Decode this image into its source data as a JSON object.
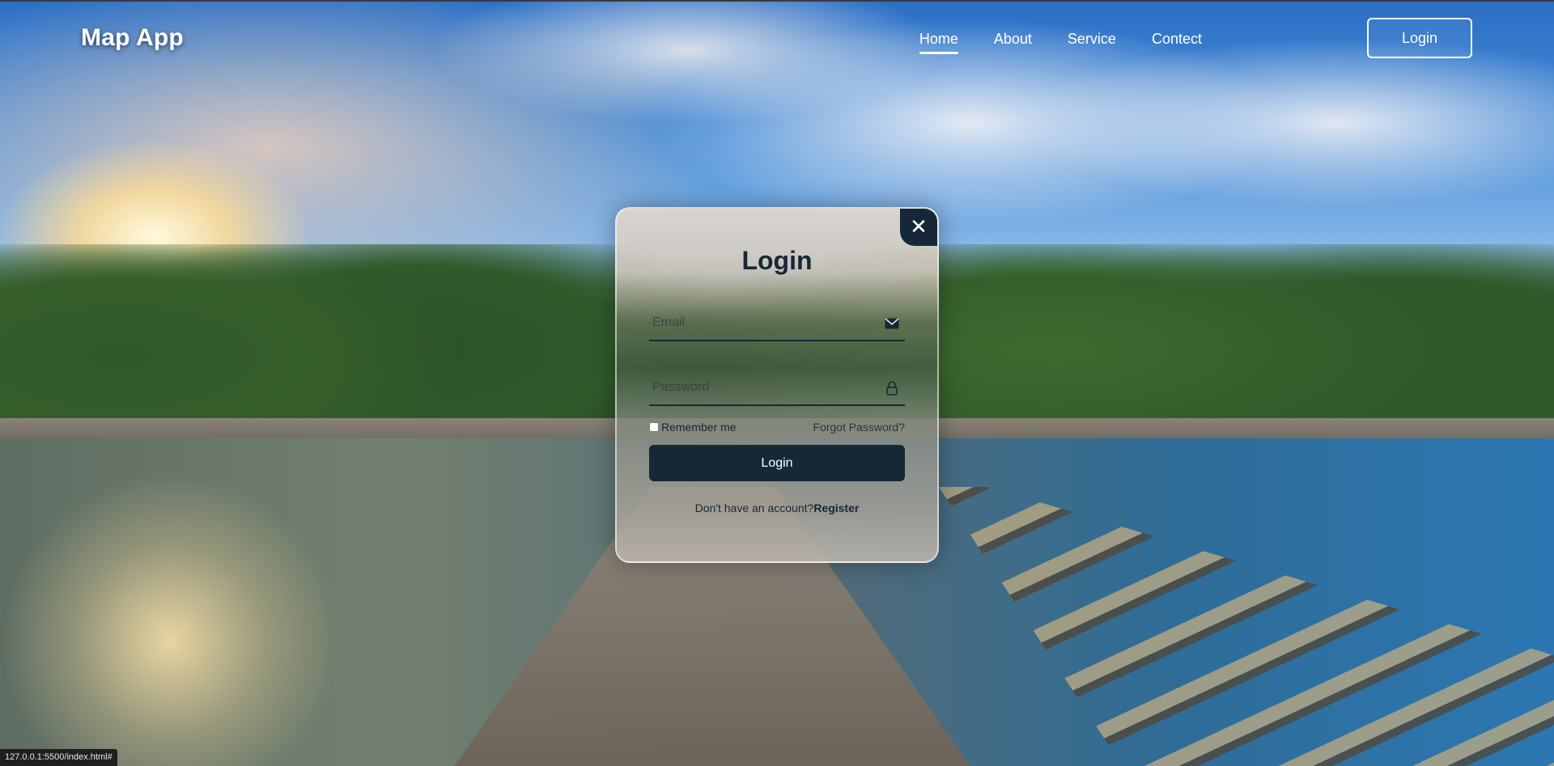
{
  "nav": {
    "logo": "Map App",
    "links": [
      {
        "label": "Home",
        "active": true
      },
      {
        "label": "About",
        "active": false
      },
      {
        "label": "Service",
        "active": false
      },
      {
        "label": "Contect",
        "active": false
      }
    ],
    "login_button": "Login"
  },
  "login_modal": {
    "title": "Login",
    "close_icon": "close-icon",
    "email": {
      "placeholder": "Email",
      "value": "",
      "icon": "mail-icon"
    },
    "password": {
      "placeholder": "Password",
      "value": "",
      "icon": "lock-icon"
    },
    "remember_label": "Remember me",
    "remember_checked": false,
    "forgot_link": "Forgot Password?",
    "submit_label": "Login",
    "register_prompt": "Don't have an account?",
    "register_link": "Register"
  },
  "status_bar": {
    "url": "127.0.0.1:5500/index.html#"
  },
  "colors": {
    "accent": "#162838",
    "nav_text": "#ffffff"
  }
}
